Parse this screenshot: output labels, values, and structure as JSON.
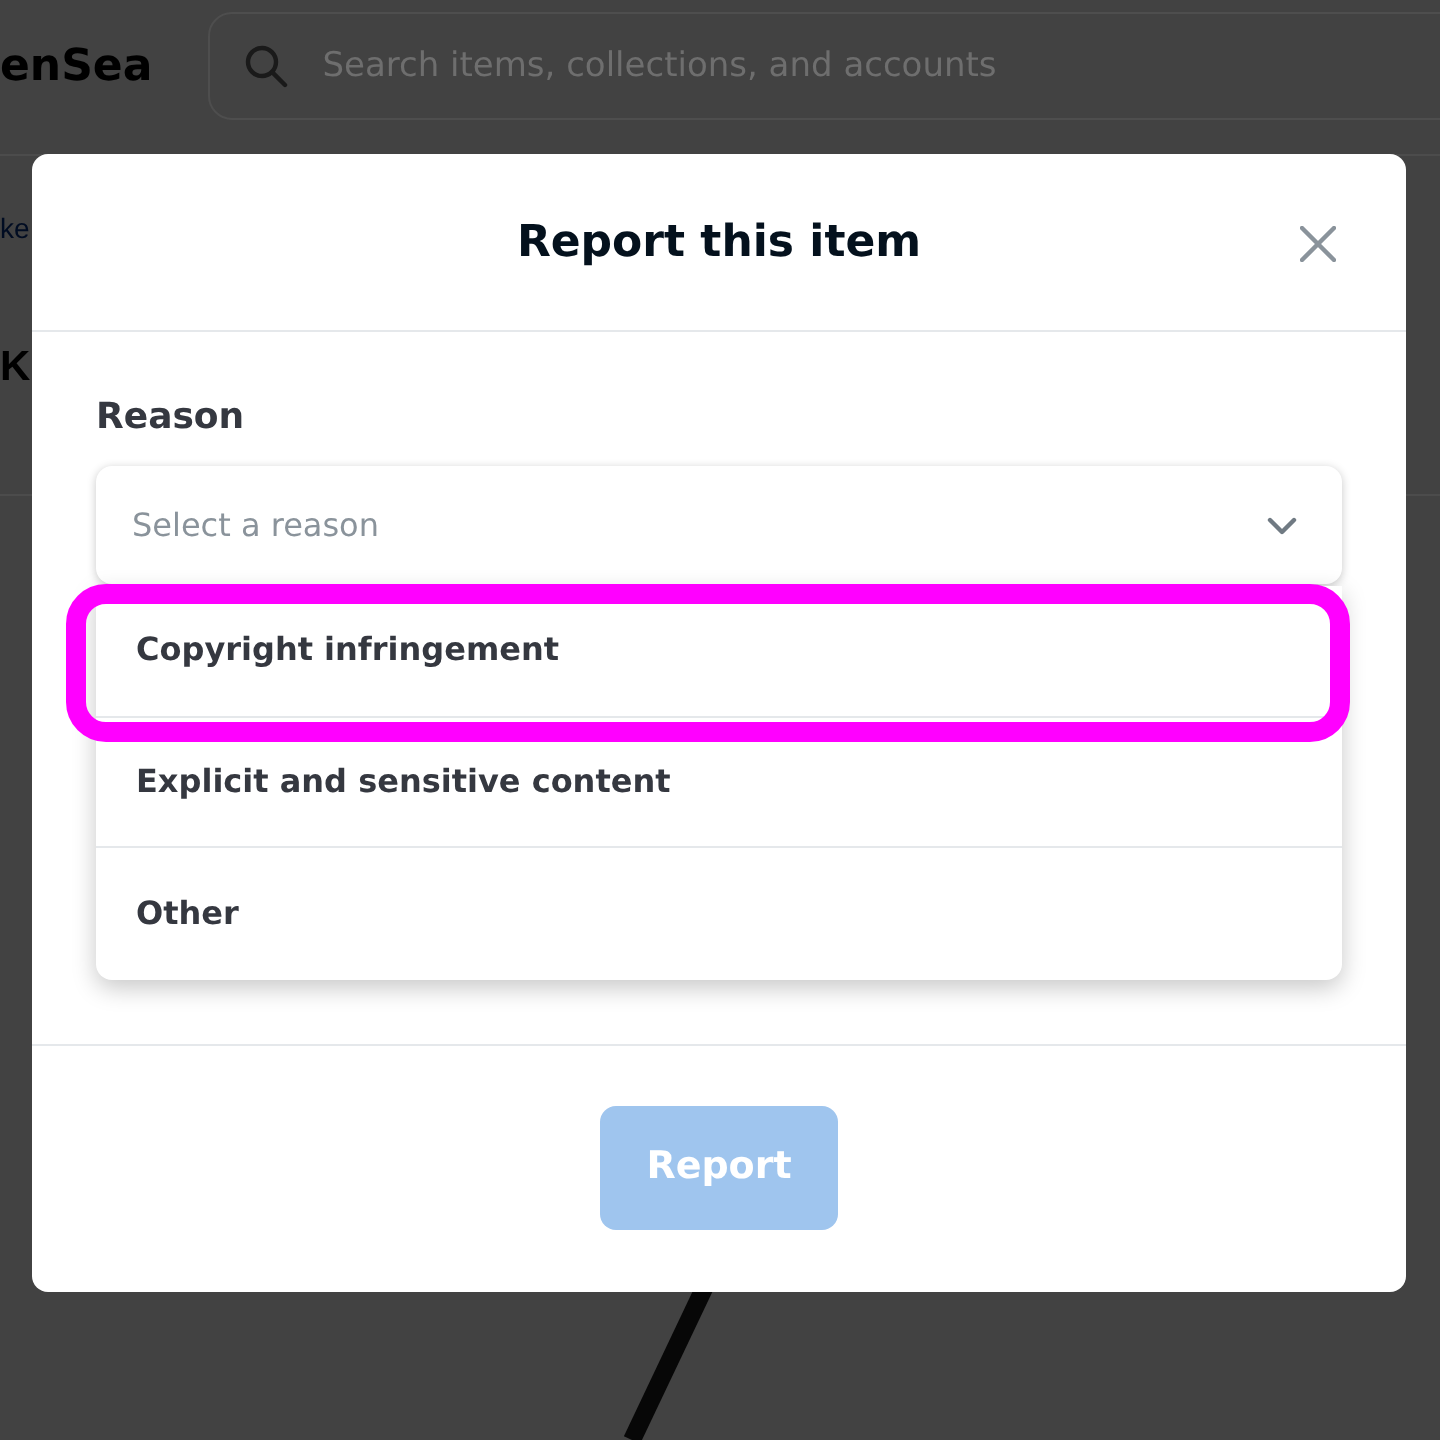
{
  "background": {
    "logo": "enSea",
    "search": {
      "placeholder": "Search items, collections, and accounts"
    },
    "link_fragment": "ke",
    "heading_fragment": "K"
  },
  "dialog": {
    "title": "Report this item",
    "field": {
      "label": "Reason",
      "placeholder": "Select a reason",
      "expanded": true
    },
    "options": [
      {
        "label": "Copyright infringement",
        "highlighted": true
      },
      {
        "label": "Explicit and sensitive content",
        "highlighted": false
      },
      {
        "label": "Other",
        "highlighted": false
      }
    ],
    "button": {
      "label": "Report",
      "disabled": true
    }
  }
}
